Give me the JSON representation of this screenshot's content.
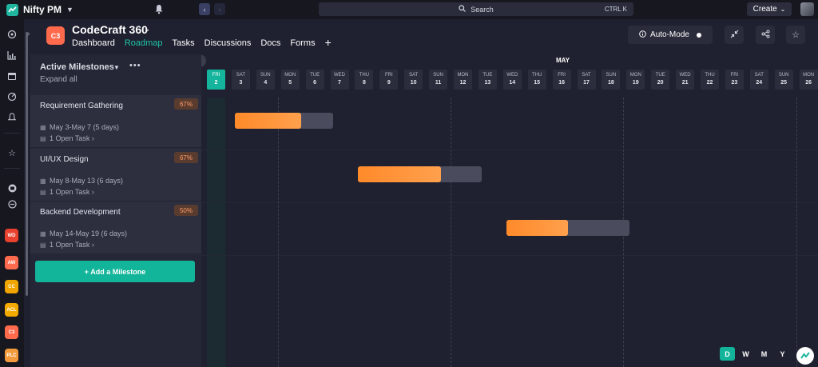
{
  "app": {
    "name": "Nifty PM"
  },
  "search": {
    "label": "Search",
    "shortcut": "CTRL K"
  },
  "topbar": {
    "create_label": "Create"
  },
  "project": {
    "badge": "C3",
    "title": "CodeCraft 360",
    "tabs": [
      {
        "label": "Dashboard",
        "active": false
      },
      {
        "label": "Roadmap",
        "active": true
      },
      {
        "label": "Tasks",
        "active": false
      },
      {
        "label": "Discussions",
        "active": false
      },
      {
        "label": "Docs",
        "active": false
      },
      {
        "label": "Forms",
        "active": false
      }
    ],
    "add_tab": "+",
    "automode_label": "Auto-Mode"
  },
  "rail": {
    "projects": [
      {
        "label": "WD",
        "color": "#e8412f"
      },
      {
        "label": "AW",
        "color": "#ff6a4d"
      },
      {
        "label": "CC",
        "color": "#f0a500"
      },
      {
        "label": "ACL",
        "color": "#f2a900"
      },
      {
        "label": "C3",
        "color": "#ff6a4d"
      },
      {
        "label": "PLC",
        "color": "#f39b3c"
      }
    ]
  },
  "milestones_panel": {
    "title": "Active Milestones",
    "expand_label": "Expand all",
    "add_label": "+ Add a Milestone",
    "items": [
      {
        "name": "Requirement Gathering",
        "percent": "67%",
        "dates": "May 3-May 7 (5 days)",
        "tasks": "1 Open Task",
        "progress": 0.67
      },
      {
        "name": "UI/UX Design",
        "percent": "67%",
        "dates": "May 8-May 13 (6 days)",
        "tasks": "1 Open Task",
        "progress": 0.67
      },
      {
        "name": "Backend Development",
        "percent": "50%",
        "dates": "May 14-May 19 (6 days)",
        "tasks": "1 Open Task",
        "progress": 0.5
      }
    ]
  },
  "timeline": {
    "month": "MAY",
    "days": [
      {
        "dow": "FRI",
        "num": "2",
        "today": true
      },
      {
        "dow": "SAT",
        "num": "3"
      },
      {
        "dow": "SUN",
        "num": "4"
      },
      {
        "dow": "MON",
        "num": "5"
      },
      {
        "dow": "TUE",
        "num": "6"
      },
      {
        "dow": "WED",
        "num": "7"
      },
      {
        "dow": "THU",
        "num": "8"
      },
      {
        "dow": "FRI",
        "num": "9"
      },
      {
        "dow": "SAT",
        "num": "10"
      },
      {
        "dow": "SUN",
        "num": "11"
      },
      {
        "dow": "MON",
        "num": "12"
      },
      {
        "dow": "TUE",
        "num": "13"
      },
      {
        "dow": "WED",
        "num": "14"
      },
      {
        "dow": "THU",
        "num": "15"
      },
      {
        "dow": "FRI",
        "num": "16"
      },
      {
        "dow": "SAT",
        "num": "17"
      },
      {
        "dow": "SUN",
        "num": "18"
      },
      {
        "dow": "MON",
        "num": "19"
      },
      {
        "dow": "TUE",
        "num": "20"
      },
      {
        "dow": "WED",
        "num": "21"
      },
      {
        "dow": "THU",
        "num": "22"
      },
      {
        "dow": "FRI",
        "num": "23"
      },
      {
        "dow": "SAT",
        "num": "24"
      },
      {
        "dow": "SUN",
        "num": "25"
      },
      {
        "dow": "MON",
        "num": "26"
      }
    ],
    "views": [
      "D",
      "W",
      "M",
      "Y"
    ],
    "active_view": "D"
  },
  "colors": {
    "accent": "#13b59a",
    "bar": "#ff8a2a",
    "track": "#4a4c5e",
    "badge": "#ff6a4d"
  }
}
